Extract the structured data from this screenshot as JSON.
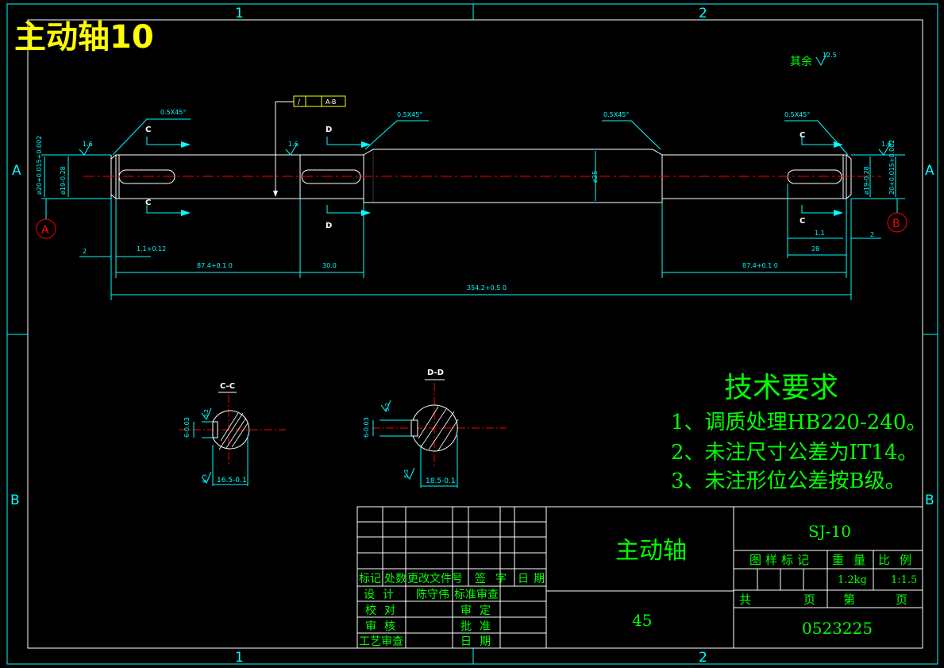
{
  "title_corner": "主动轴10",
  "zone_marks": {
    "top_left": "1",
    "top_right": "2",
    "left_a": "A",
    "left_b": "B",
    "right_a": "A",
    "right_b": "B",
    "bottom_left": "1",
    "bottom_right": "2"
  },
  "roughness_default": "其余",
  "roughness_default_value": "12.5",
  "shaft": {
    "chamfer_1": "0.5X45°",
    "chamfer_2": "0.5X45°",
    "chamfer_3": "0.5X45°",
    "chamfer_4": "0.5X45°",
    "datum_a": "A",
    "datum_b": "B",
    "tolerance_frame": {
      "symbol": "/",
      "value": "",
      "ref": "A-B"
    },
    "section_c_label_1": "C",
    "section_c_label_2": "C",
    "section_c_label_3": "C",
    "section_c_label_4": "C",
    "section_d_label_1": "D",
    "section_d_label_2": "D",
    "roughness_1": "1.6",
    "roughness_2": "1.6",
    "roughness_3": "1.6",
    "dia_left_outer": "ø20+0.015+0.002",
    "dia_left_inner": "ø19-0.28",
    "dia_mid": "ø25",
    "dia_right_inner": "ø19-0.28",
    "dia_right_outer": "20+0.015+0.002",
    "dim_2_left": "2",
    "dim_1_1_left": "1.1+0.12",
    "dim_87_left": "87.4+0.1 0",
    "dim_30": "30.0",
    "dim_87_right": "87.4+0.1 0",
    "dim_1_1_right": "1.1",
    "dim_2_right": "2",
    "dim_28": "28",
    "dim_total": "354.2+0.5 0"
  },
  "sections": {
    "cc_title": "C-C",
    "dd_title": "D-D",
    "cc_width": "16.5-0.1",
    "dd_width": "18.5-0.1",
    "cc_key": "6-0.03",
    "dd_key": "6-0.03",
    "cc_rough_a": "3.2",
    "cc_rough_b": "6.3",
    "dd_rough_a": "3.2",
    "dd_rough_b": "6.3"
  },
  "tech_req": {
    "title": "技术要求",
    "items": [
      "1、调质处理HB220-240。",
      "2、未注尺寸公差为IT14。",
      "3、未注形位公差按B级。"
    ]
  },
  "title_block": {
    "part_name": "主动轴",
    "material": "45",
    "drawing_no": "SJ-10",
    "headers": [
      "图样标记",
      "重量",
      "比例"
    ],
    "weight": "1.2kg",
    "scale": "1:1.5",
    "sheets_total": "共",
    "sheets_unit_1": "页",
    "sheet_no": "第",
    "sheets_unit_2": "页",
    "code": "0523225",
    "rev_headers": [
      "标记",
      "处数",
      "更改文件号",
      "签字",
      "日期"
    ],
    "rows": [
      {
        "a": "设计",
        "b": "陈守伟",
        "c": "标准审查"
      },
      {
        "a": "校对",
        "b": "",
        "c": "审定"
      },
      {
        "a": "审核",
        "b": "",
        "c": "批准"
      },
      {
        "a": "工艺审查",
        "b": "",
        "c": "日期"
      }
    ]
  },
  "colors": {
    "frame": "#ffffff",
    "cyan": "#00ffff",
    "green": "#00ff00",
    "yellow": "#ffff00",
    "red": "#ff0000",
    "bg": "#000000"
  }
}
